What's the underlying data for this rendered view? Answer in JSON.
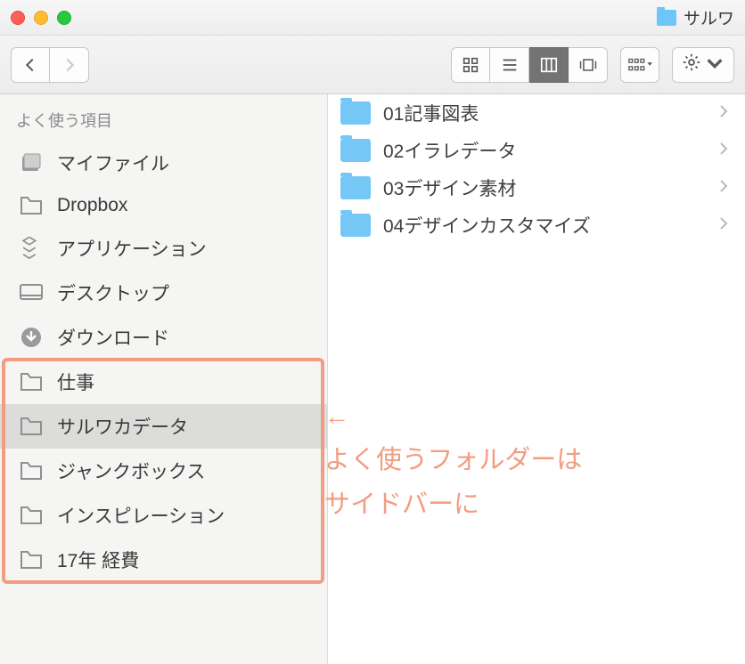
{
  "title": {
    "window_title": "サルワ"
  },
  "sidebar": {
    "header": "よく使う項目",
    "items": [
      {
        "label": "マイファイル",
        "icon": "doc-stack"
      },
      {
        "label": "Dropbox",
        "icon": "folder-outline"
      },
      {
        "label": "アプリケーション",
        "icon": "apps"
      },
      {
        "label": "デスクトップ",
        "icon": "desktop"
      },
      {
        "label": "ダウンロード",
        "icon": "download"
      },
      {
        "label": "仕事",
        "icon": "folder-outline"
      },
      {
        "label": "サルワカデータ",
        "icon": "folder-outline",
        "selected": true
      },
      {
        "label": "ジャンクボックス",
        "icon": "folder-outline"
      },
      {
        "label": "インスピレーション",
        "icon": "folder-outline"
      },
      {
        "label": "17年 経費",
        "icon": "folder-outline"
      }
    ]
  },
  "files": [
    {
      "name": "01記事図表"
    },
    {
      "name": "02イラレデータ"
    },
    {
      "name": "03デザイン素材"
    },
    {
      "name": "04デザインカスタマイズ"
    }
  ],
  "annotation": {
    "arrow": "←",
    "line1": "よく使うフォルダーは",
    "line2": "サイドバーに"
  },
  "highlight": {
    "start_index": 5,
    "end_index": 9
  }
}
